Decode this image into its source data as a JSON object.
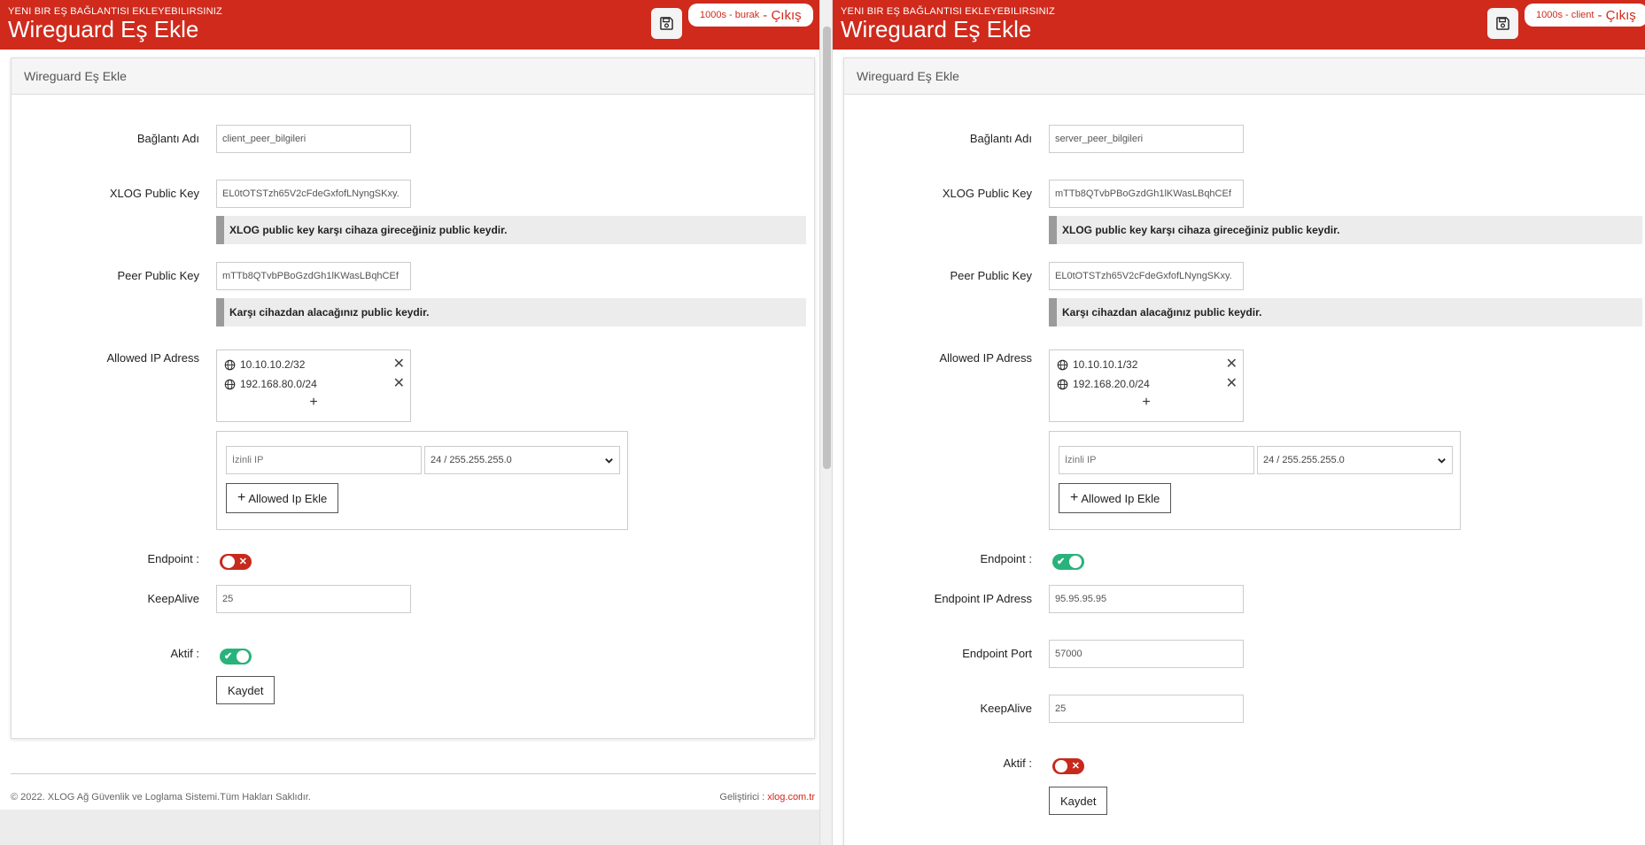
{
  "left": {
    "header": {
      "subtitle": "YENI BIR EŞ BAĞLANTISI EKLEYEBILIRSINIZ",
      "title": "Wireguard Eş Ekle",
      "user": "1000s - burak",
      "separator": "-",
      "logout": "Çıkış"
    },
    "card_title": "Wireguard Eş Ekle",
    "form": {
      "name_label": "Bağlantı Adı",
      "name_value": "client_peer_bilgileri",
      "xlog_key_label": "XLOG Public Key",
      "xlog_key_value": "EL0tOTSTzh65V2cFdeGxfofLNyngSKxy.",
      "xlog_key_hint": "XLOG public key karşı cihaza gireceğiniz public keydir.",
      "peer_key_label": "Peer Public Key",
      "peer_key_value": "mTTb8QTvbPBoGzdGh1lKWasLBqhCEf",
      "peer_key_hint": "Karşı cihazdan alacağınız public keydir.",
      "allowed_label": "Allowed IP Adress",
      "allowed_ips": [
        "10.10.10.2/32",
        "192.168.80.0/24"
      ],
      "add_symbol": "+",
      "ip_placeholder": "İzinli IP",
      "mask_selected": "24 / 255.255.255.0",
      "add_ip_button": "Allowed Ip Ekle",
      "endpoint_label": "Endpoint :",
      "endpoint_enabled": false,
      "keepalive_label": "KeepAlive",
      "keepalive_value": "25",
      "active_label": "Aktif :",
      "active_enabled": true,
      "save_button": "Kaydet"
    },
    "footer": {
      "copyright": "© 2022. XLOG Ağ Güvenlik ve Loglama Sistemi.Tüm Hakları Saklıdır.",
      "developer_label": "Geliştirici : ",
      "developer_link": "xlog.com.tr"
    }
  },
  "right": {
    "header": {
      "subtitle": "YENI BIR EŞ BAĞLANTISI EKLEYEBILIRSINIZ",
      "title": "Wireguard Eş Ekle",
      "user": "1000s - client",
      "separator": "-",
      "logout": "Çıkış"
    },
    "card_title": "Wireguard Eş Ekle",
    "form": {
      "name_label": "Bağlantı Adı",
      "name_value": "server_peer_bilgileri",
      "xlog_key_label": "XLOG Public Key",
      "xlog_key_value": "mTTb8QTvbPBoGzdGh1lKWasLBqhCEf",
      "xlog_key_hint": "XLOG public key karşı cihaza gireceğiniz public keydir.",
      "peer_key_label": "Peer Public Key",
      "peer_key_value": "EL0tOTSTzh65V2cFdeGxfofLNyngSKxy.",
      "peer_key_hint": "Karşı cihazdan alacağınız public keydir.",
      "allowed_label": "Allowed IP Adress",
      "allowed_ips": [
        "10.10.10.1/32",
        "192.168.20.0/24"
      ],
      "add_symbol": "+",
      "ip_placeholder": "İzinli IP",
      "mask_selected": "24 / 255.255.255.0",
      "add_ip_button": "Allowed Ip Ekle",
      "endpoint_label": "Endpoint :",
      "endpoint_enabled": true,
      "endpoint_ip_label": "Endpoint IP Adress",
      "endpoint_ip_value": "95.95.95.95",
      "endpoint_port_label": "Endpoint Port",
      "endpoint_port_value": "57000",
      "keepalive_label": "KeepAlive",
      "keepalive_value": "25",
      "active_label": "Aktif :",
      "active_enabled": false,
      "save_button": "Kaydet"
    }
  },
  "colors": {
    "brand": "#cf2a1c",
    "toggle_on": "#2ab27b",
    "toggle_off": "#c62a1c"
  },
  "icons": {
    "save": "floppy-disk-icon",
    "globe": "globe-icon",
    "remove": "close-icon",
    "select": "chevron-down-icon"
  }
}
